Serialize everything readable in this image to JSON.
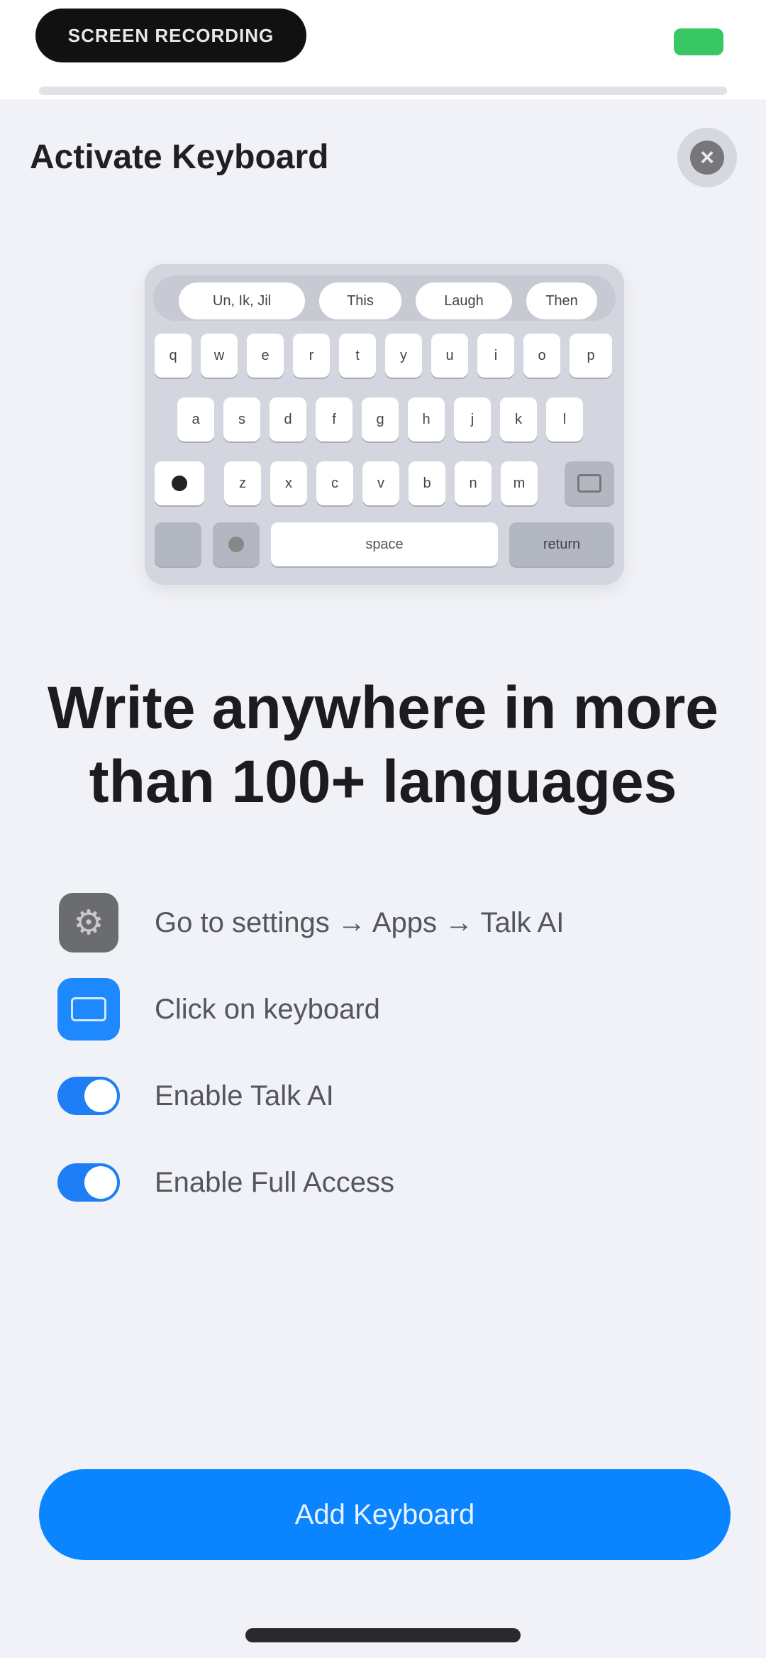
{
  "status_bar": {
    "pill_text": "SCREEN RECORDING"
  },
  "sheet": {
    "title": "Activate Keyboard",
    "close_glyph": "×"
  },
  "keyboard_preview": {
    "suggestions": [
      "Un, Ik, Jil",
      "This",
      "Laugh",
      "Then"
    ],
    "row1": [
      "q",
      "w",
      "e",
      "r",
      "t",
      "y",
      "u",
      "i",
      "o",
      "p"
    ],
    "row2": [
      "a",
      "s",
      "d",
      "f",
      "g",
      "h",
      "j",
      "k",
      "l"
    ],
    "row3": [
      "z",
      "x",
      "c",
      "v",
      "b",
      "n",
      "m"
    ],
    "space_label": "space",
    "return_label": "return"
  },
  "headline": "Write anywhere in more than 100+ languages",
  "steps": [
    {
      "icon": "gear-icon",
      "label": "Go to settings → Apps → Talk AI"
    },
    {
      "icon": "keyboard-icon",
      "label": "Click on keyboard"
    },
    {
      "icon": "toggle-icon",
      "label": "Enable Talk AI"
    },
    {
      "icon": "toggle-icon",
      "label": "Enable Full Access"
    }
  ],
  "cta": {
    "label": "Add Keyboard"
  },
  "colors": {
    "accent": "#0a84ff",
    "toggle": "#1e7ef5",
    "battery": "#38c762",
    "background": "#f1f2f7"
  }
}
